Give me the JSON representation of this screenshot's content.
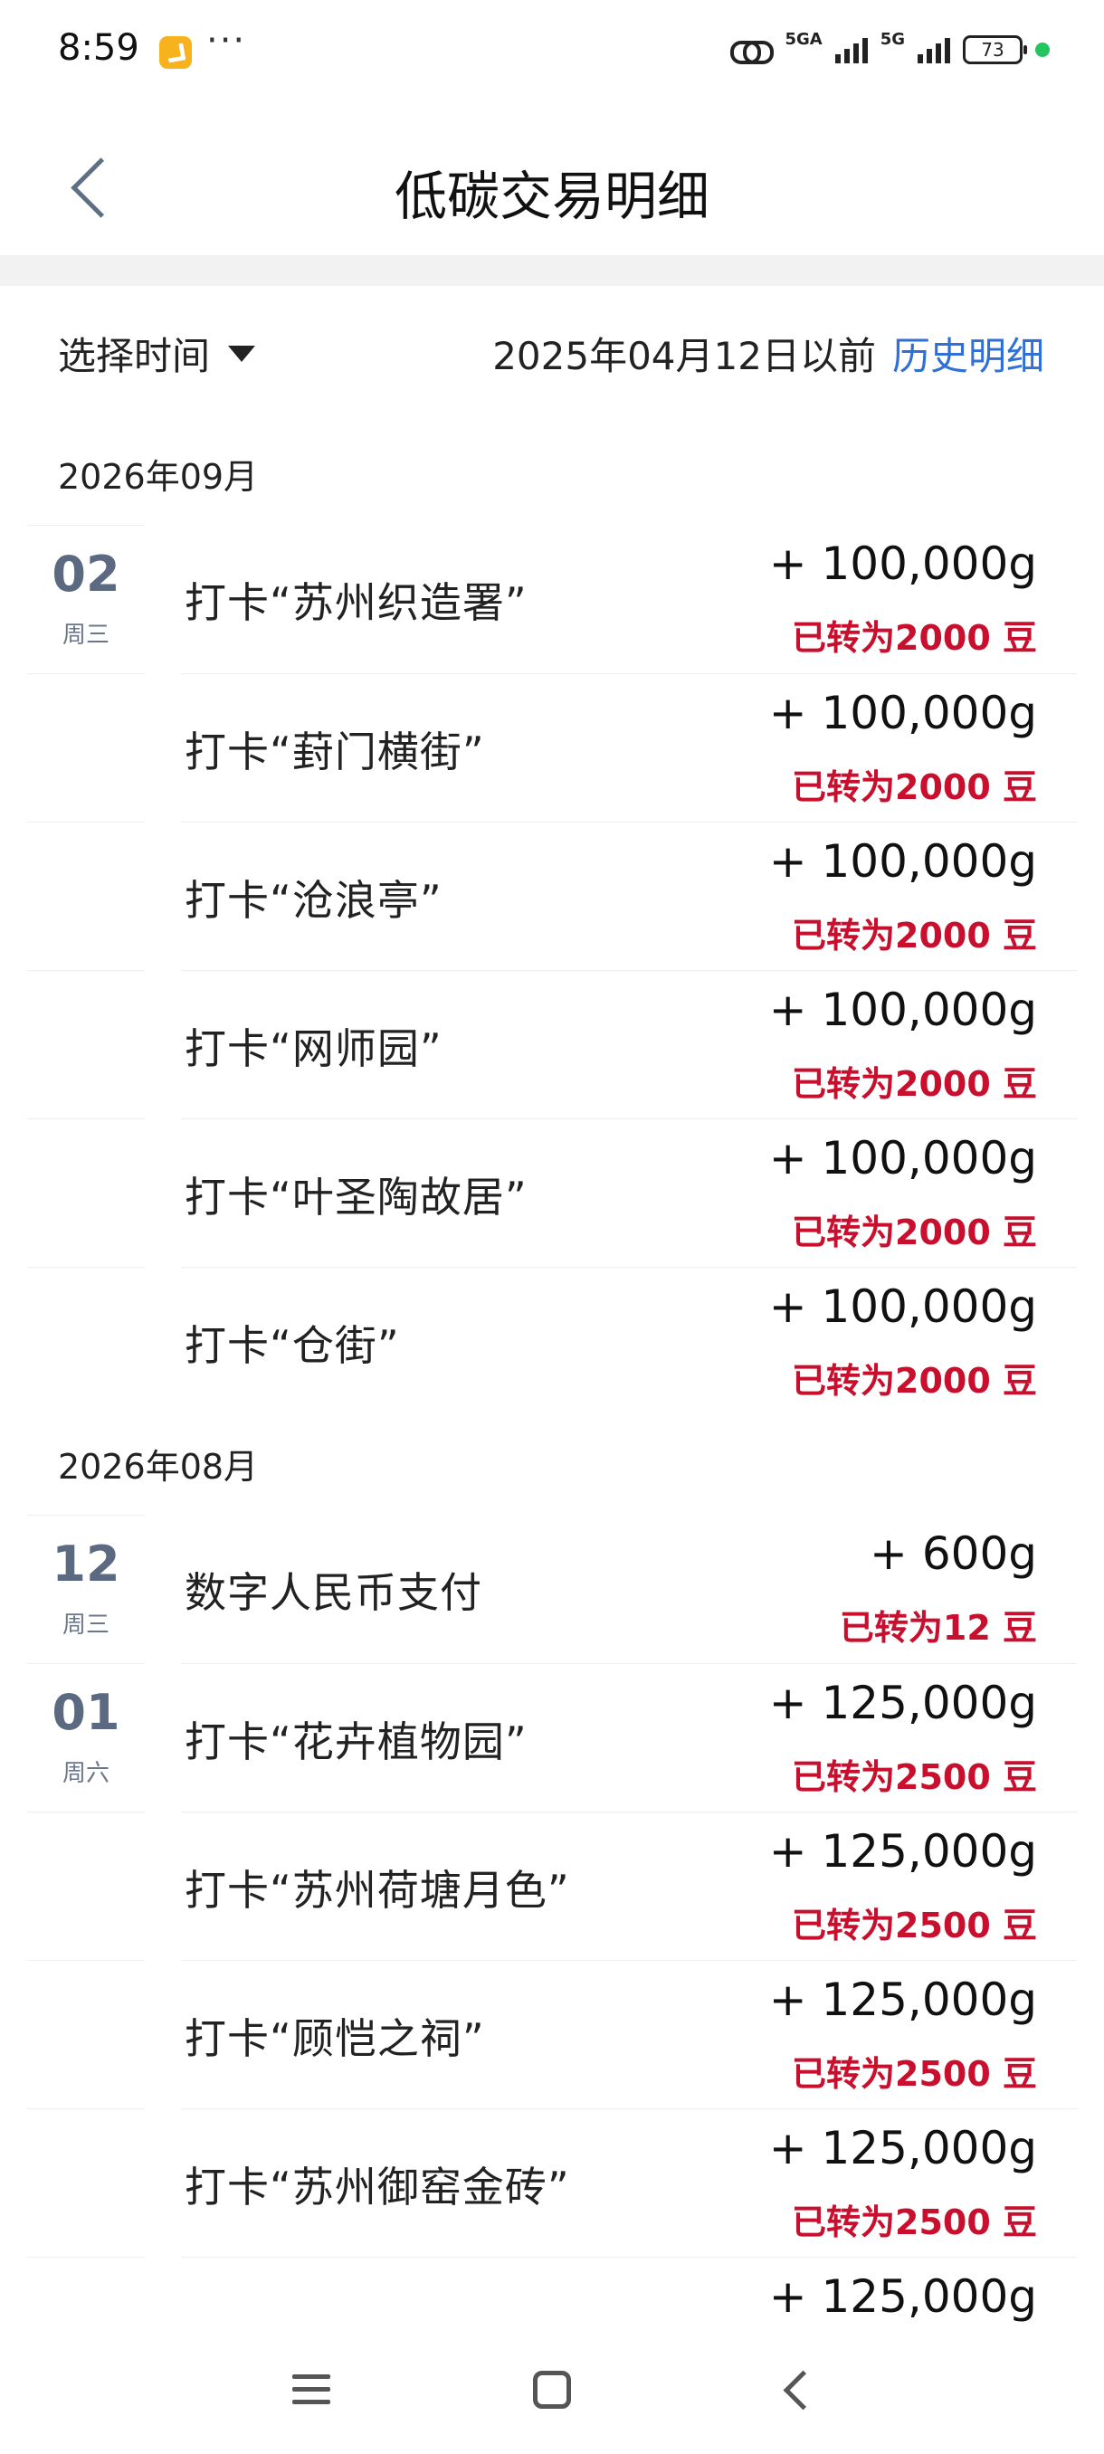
{
  "status_bar": {
    "time": "8:59",
    "more": "···",
    "network_1": "5GA",
    "network_2": "5G",
    "battery": "73",
    "icons": [
      "app-notification-icon",
      "hd-call-icon",
      "signal-icon",
      "battery-icon"
    ]
  },
  "header": {
    "title": "低碳交易明细"
  },
  "filter": {
    "select_label": "选择时间",
    "cutoff": "2025年04月12日以前",
    "history_link": "历史明细"
  },
  "months": [
    {
      "label": "2026年09月",
      "rows": [
        {
          "day": "02",
          "weekday": "周三",
          "title": "打卡“苏州织造署”",
          "amount": "+ 100,000g",
          "converted": "已转为2000 豆"
        },
        {
          "day": "",
          "weekday": "",
          "title": "打卡“葑门横街”",
          "amount": "+ 100,000g",
          "converted": "已转为2000 豆"
        },
        {
          "day": "",
          "weekday": "",
          "title": "打卡“沧浪亭”",
          "amount": "+ 100,000g",
          "converted": "已转为2000 豆"
        },
        {
          "day": "",
          "weekday": "",
          "title": "打卡“网师园”",
          "amount": "+ 100,000g",
          "converted": "已转为2000 豆"
        },
        {
          "day": "",
          "weekday": "",
          "title": "打卡“叶圣陶故居”",
          "amount": "+ 100,000g",
          "converted": "已转为2000 豆"
        },
        {
          "day": "",
          "weekday": "",
          "title": "打卡“仓街”",
          "amount": "+ 100,000g",
          "converted": "已转为2000 豆"
        }
      ]
    },
    {
      "label": "2026年08月",
      "rows": [
        {
          "day": "12",
          "weekday": "周三",
          "title": "数字人民币支付",
          "amount": "+ 600g",
          "converted": "已转为12 豆"
        },
        {
          "day": "01",
          "weekday": "周六",
          "title": "打卡“花卉植物园”",
          "amount": "+ 125,000g",
          "converted": "已转为2500 豆"
        },
        {
          "day": "",
          "weekday": "",
          "title": "打卡“苏州荷塘月色”",
          "amount": "+ 125,000g",
          "converted": "已转为2500 豆"
        },
        {
          "day": "",
          "weekday": "",
          "title": "打卡“顾恺之祠”",
          "amount": "+ 125,000g",
          "converted": "已转为2500 豆"
        },
        {
          "day": "",
          "weekday": "",
          "title": "打卡“苏州御窑金砖”",
          "amount": "+ 125,000g",
          "converted": "已转为2500 豆"
        },
        {
          "day": "",
          "weekday": "",
          "title": "",
          "amount": "+ 125,000g",
          "converted": ""
        }
      ]
    }
  ],
  "nav_bar": {
    "icons": [
      "menu-icon",
      "home-icon",
      "back-icon"
    ]
  },
  "colors": {
    "accent_link": "#2f6fd6",
    "converted_red": "#c8102e",
    "date_slate": "#5b6a80"
  }
}
